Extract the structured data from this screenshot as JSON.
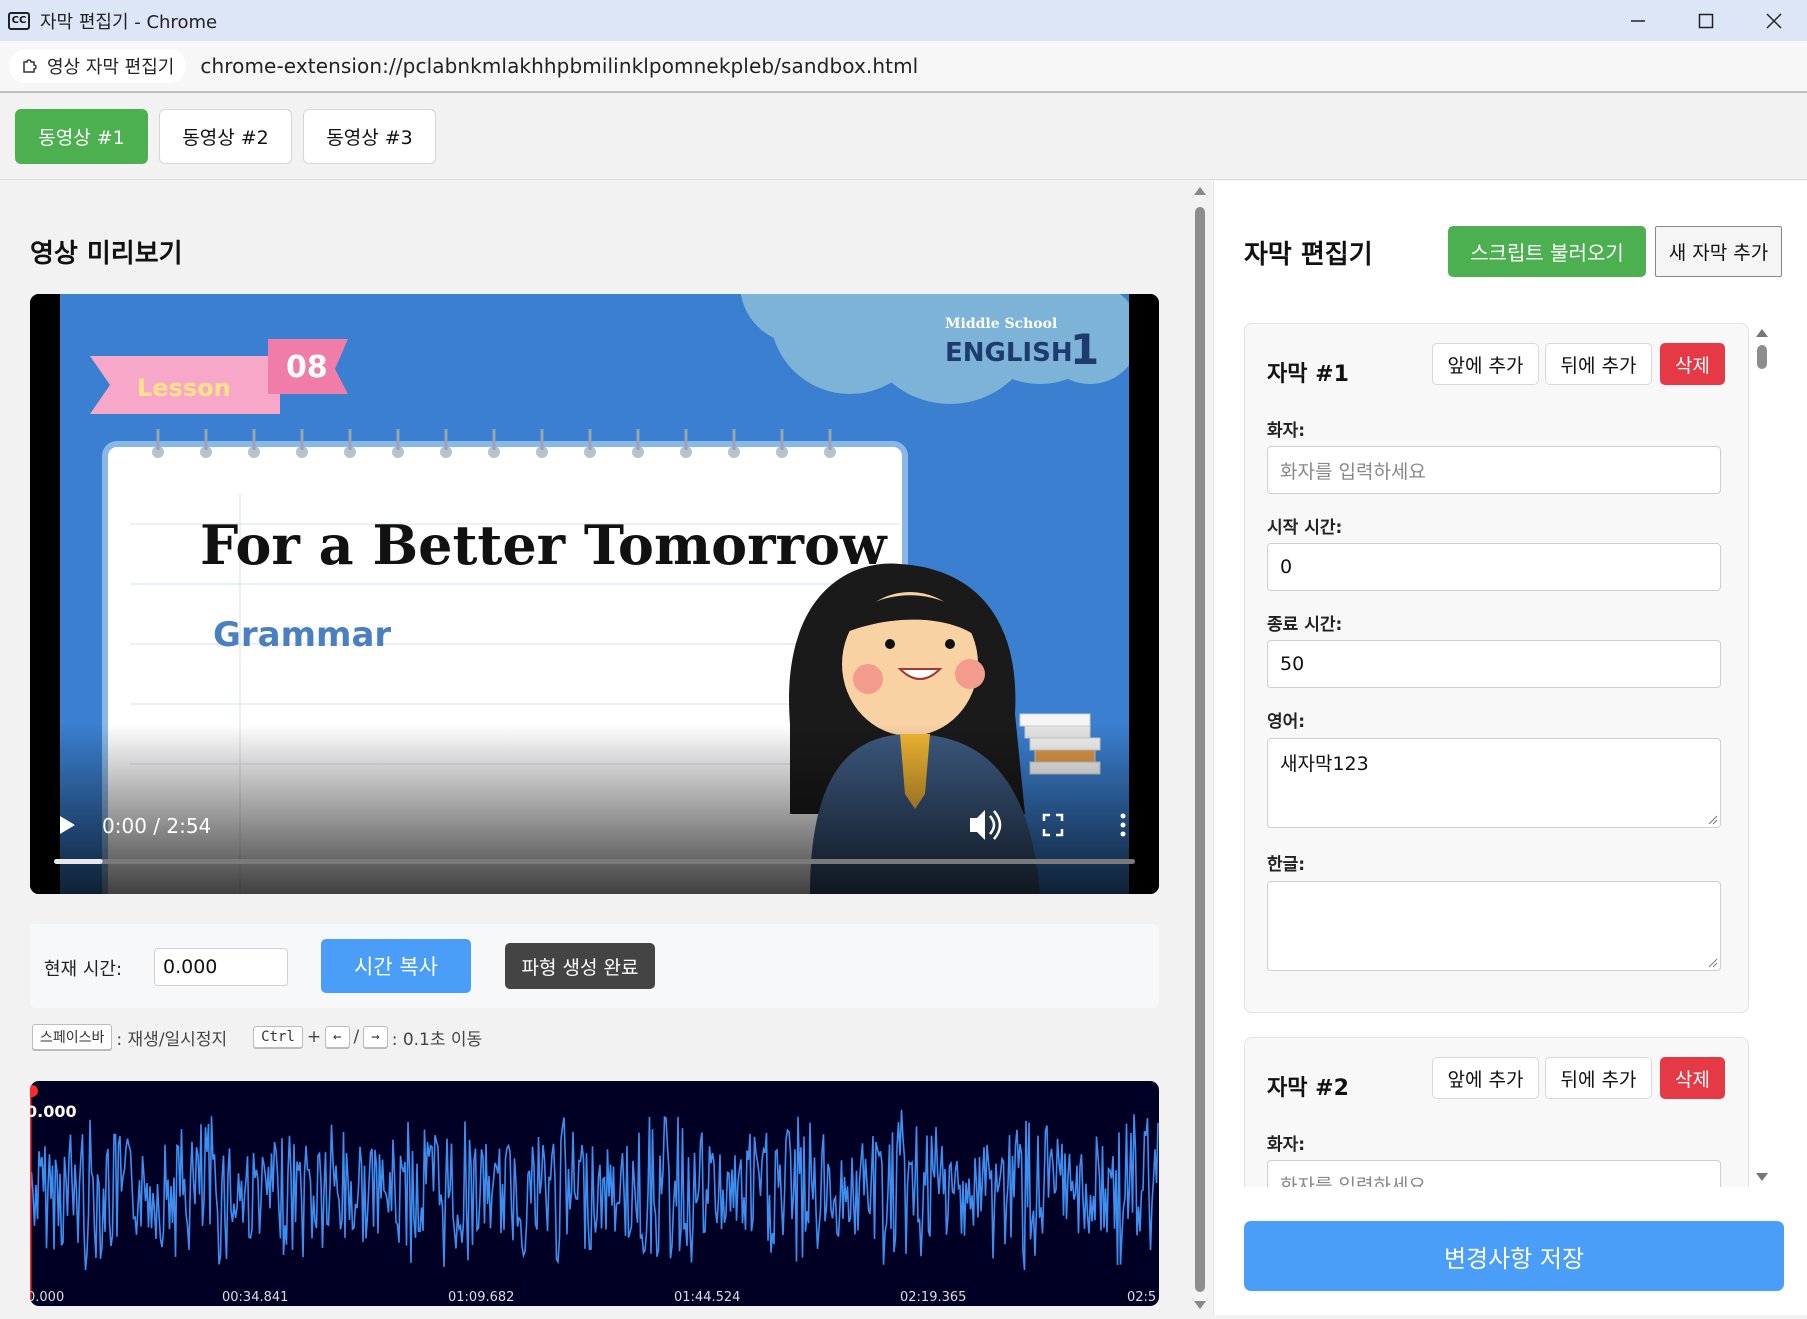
{
  "window": {
    "title": "자막 편집기 - Chrome",
    "app_icon": "CC",
    "minimize_icon": "minimize-icon",
    "maximize_icon": "maximize-icon",
    "close_icon": "close-icon"
  },
  "addressbar": {
    "chip_label": "영상 자막 편집기",
    "url": "chrome-extension://pclabnkmlakhhpbmilinklpomnekpleb/sandbox.html"
  },
  "video_tabs": [
    {
      "label": "동영상 #1",
      "active": true
    },
    {
      "label": "동영상 #2",
      "active": false
    },
    {
      "label": "동영상 #3",
      "active": false
    }
  ],
  "preview": {
    "heading": "영상 미리보기",
    "time_display": "0:00 / 2:54",
    "progress_fraction": 0.045,
    "thumbnail": {
      "lesson_label": "Lesson",
      "lesson_number": "08",
      "series_small": "Middle School",
      "series_big": "ENGLISH",
      "series_number": "1",
      "title": "For a Better Tomorrow",
      "subtitle": "Grammar"
    }
  },
  "controls": {
    "current_time_label": "현재 시간:",
    "current_time_value": "0.000",
    "copy_time_label": "시간 복사",
    "waveform_done_label": "파형 생성 완료"
  },
  "hints": {
    "space_key": "스페이스바",
    "space_desc": ": 재생/일시정지",
    "ctrl_key": "Ctrl",
    "plus": "+",
    "left_key": "←",
    "slash": "/",
    "right_key": "→",
    "arrow_desc": ": 0.1초 이동"
  },
  "waveform": {
    "cursor_time": "0.000",
    "ticks": [
      "0.000",
      "00:34.841",
      "01:09.682",
      "01:44.524",
      "02:19.365",
      "02:5"
    ],
    "wave_color": "#3e8ef0",
    "background_color": "#000025"
  },
  "editor": {
    "heading": "자막 편집기",
    "load_script_label": "스크립트 불러오기",
    "add_subtitle_label": "새 자막 추가",
    "save_label": "변경사항 저장",
    "subtitles": [
      {
        "title": "자막 #1",
        "add_before": "앞에 추가",
        "add_after": "뒤에 추가",
        "delete": "삭제",
        "speaker_label": "화자:",
        "speaker_placeholder": "화자를 입력하세요",
        "start_label": "시작 시간:",
        "start_value": "0",
        "end_label": "종료 시간:",
        "end_value": "50",
        "english_label": "영어:",
        "english_value": "새자막123",
        "korean_label": "한글:",
        "korean_value": ""
      },
      {
        "title": "자막 #2",
        "add_before": "앞에 추가",
        "add_after": "뒤에 추가",
        "delete": "삭제",
        "speaker_label": "화자:",
        "speaker_placeholder": "화자를 입력하세요"
      }
    ]
  },
  "colors": {
    "green": "#4caf50",
    "blue": "#4a9ef8",
    "red": "#e53946",
    "dark": "#444444"
  }
}
